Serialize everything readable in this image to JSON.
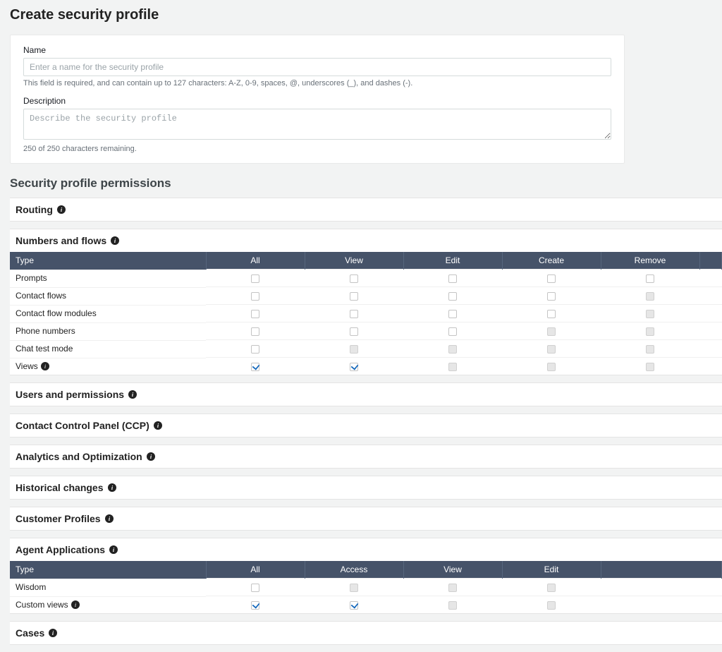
{
  "page": {
    "title": "Create security profile"
  },
  "form": {
    "name_label": "Name",
    "name_placeholder": "Enter a name for the security profile",
    "name_help": "This field is required, and can contain up to 127 characters: A-Z, 0-9, spaces, @, underscores (_), and dashes (-).",
    "desc_label": "Description",
    "desc_placeholder": "Describe the security profile",
    "desc_help": "250 of 250 characters remaining."
  },
  "perms": {
    "title": "Security profile permissions",
    "groups": {
      "routing": {
        "label": "Routing"
      },
      "numbers_flows": {
        "label": "Numbers and flows",
        "headers": [
          "Type",
          "All",
          "View",
          "Edit",
          "Create",
          "Remove",
          ""
        ],
        "rows": [
          {
            "label": "Prompts",
            "info": false,
            "cells": [
              "unchecked",
              "unchecked",
              "unchecked",
              "unchecked",
              "unchecked"
            ]
          },
          {
            "label": "Contact flows",
            "info": false,
            "cells": [
              "unchecked",
              "unchecked",
              "unchecked",
              "unchecked",
              "disabled"
            ]
          },
          {
            "label": "Contact flow modules",
            "info": false,
            "cells": [
              "unchecked",
              "unchecked",
              "unchecked",
              "unchecked",
              "disabled"
            ]
          },
          {
            "label": "Phone numbers",
            "info": false,
            "cells": [
              "unchecked",
              "unchecked",
              "unchecked",
              "disabled",
              "disabled"
            ]
          },
          {
            "label": "Chat test mode",
            "info": false,
            "cells": [
              "unchecked",
              "disabled",
              "disabled",
              "disabled",
              "disabled"
            ]
          },
          {
            "label": "Views",
            "info": true,
            "cells": [
              "checked",
              "checked",
              "disabled",
              "disabled",
              "disabled"
            ]
          }
        ]
      },
      "users_permissions": {
        "label": "Users and permissions"
      },
      "ccp": {
        "label": "Contact Control Panel (CCP)"
      },
      "analytics": {
        "label": "Analytics and Optimization"
      },
      "historical": {
        "label": "Historical changes"
      },
      "customer_profiles": {
        "label": "Customer Profiles"
      },
      "agent_apps": {
        "label": "Agent Applications",
        "headers": [
          "Type",
          "All",
          "Access",
          "View",
          "Edit",
          ""
        ],
        "rows": [
          {
            "label": "Wisdom",
            "info": false,
            "cells": [
              "unchecked",
              "disabled",
              "disabled",
              "disabled"
            ]
          },
          {
            "label": "Custom views",
            "info": true,
            "cells": [
              "checked",
              "checked",
              "disabled",
              "disabled"
            ]
          }
        ]
      },
      "cases": {
        "label": "Cases"
      }
    }
  }
}
